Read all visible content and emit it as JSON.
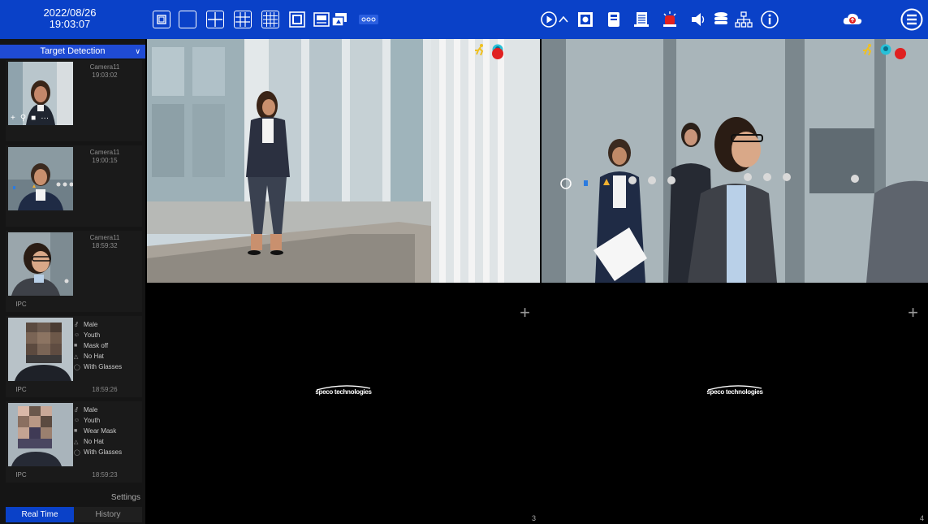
{
  "topbar": {
    "date": "2022/08/26",
    "time": "19:03:07",
    "layout_buttons": [
      "single-view",
      "1-split",
      "4-split",
      "9-split",
      "16-split",
      "custom-split",
      "sequence",
      "more"
    ],
    "right_icons": [
      "playback-icon",
      "chevron-up-icon",
      "snapshot-icon",
      "manual-record-icon",
      "search-icon",
      "alarm-icon",
      "audio-icon",
      "disk-icon",
      "network-icon",
      "info-icon",
      "cloud-upgrade-icon",
      "menu-icon"
    ]
  },
  "sidebar": {
    "title": "Target Detection",
    "cards": [
      {
        "camera": "Camera11",
        "time": "19:03:02",
        "source": "",
        "attributes": []
      },
      {
        "camera": "Camera11",
        "time": "19:00:15",
        "source": "",
        "attributes": []
      },
      {
        "camera": "Camera11",
        "time": "18:59:32",
        "source": "IPC",
        "attributes": []
      },
      {
        "camera": "",
        "time": "18:59:26",
        "source": "IPC",
        "attributes": [
          "Male",
          "Youth",
          "Mask off",
          "No Hat",
          "With Glasses"
        ]
      },
      {
        "camera": "",
        "time": "18:59:23",
        "source": "IPC",
        "attributes": [
          "Male",
          "Youth",
          "Wear Mask",
          "No Hat",
          "With Glasses"
        ]
      }
    ],
    "settings_label": "Settings",
    "tabs": {
      "realtime": "Real Time",
      "history": "History"
    }
  },
  "cells": [
    {
      "number": "",
      "content": "live"
    },
    {
      "number": "",
      "content": "live"
    },
    {
      "number": "3",
      "logo": "speco technologies",
      "content": "empty"
    },
    {
      "number": "4",
      "logo": "speco technologies",
      "content": "empty"
    }
  ],
  "colors": {
    "toolbar": "#0a41c8",
    "accent": "#1f4bd4",
    "record": "#e02020"
  }
}
